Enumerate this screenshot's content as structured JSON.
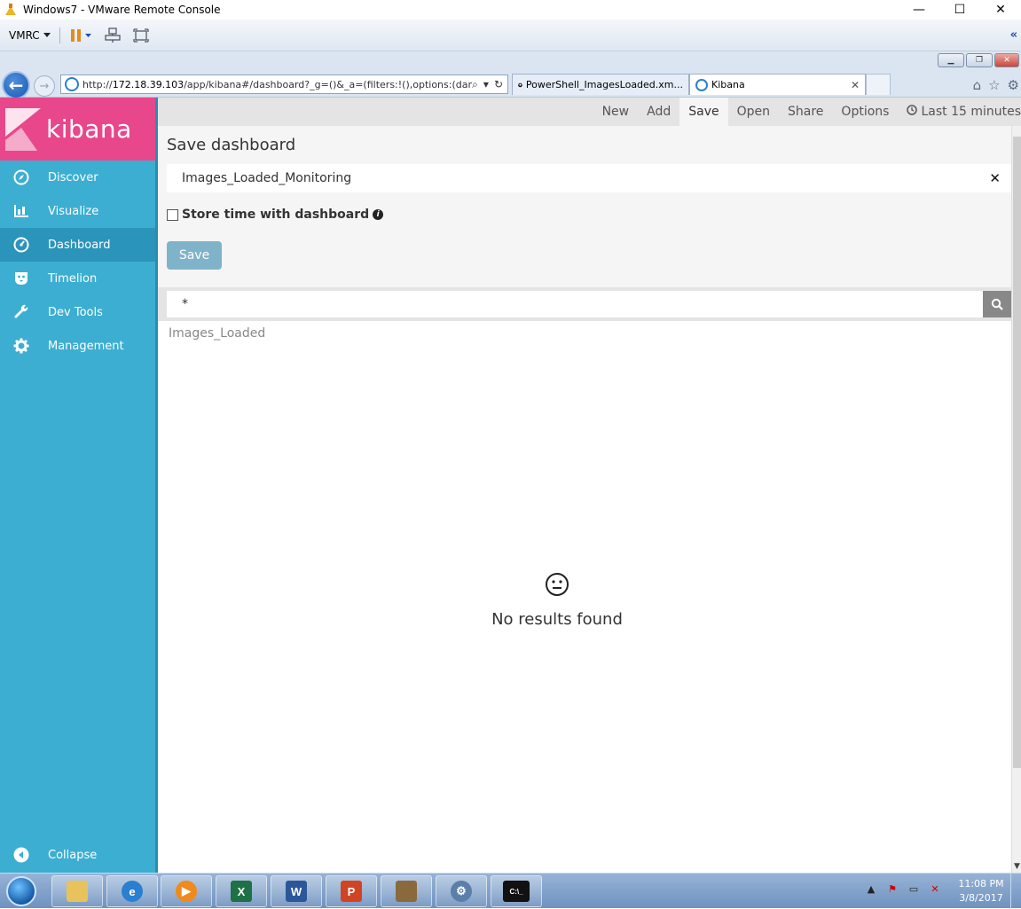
{
  "vm_window": {
    "title": "Windows7 - VMware Remote Console",
    "minimize": "—",
    "maximize": "☐",
    "close": "✕"
  },
  "vmrc_toolbar": {
    "menu_label": "VMRC",
    "collapse": "«"
  },
  "browser": {
    "address": {
      "url_prefix": "http://",
      "url_host": "172.18.39.103",
      "url_rest": "/app/kibana#/dashboard?_g=()&_a=(filters:!(),options:(darkT"
    },
    "tabs": [
      {
        "label": "PowerShell_ImagesLoaded.xm..."
      },
      {
        "label": "Kibana",
        "close": "✕"
      }
    ]
  },
  "kibana": {
    "logo_text": "kibana",
    "nav": [
      {
        "label": "Discover",
        "icon": "compass-icon"
      },
      {
        "label": "Visualize",
        "icon": "bar-chart-icon"
      },
      {
        "label": "Dashboard",
        "icon": "dashboard-gauge-icon",
        "active": true
      },
      {
        "label": "Timelion",
        "icon": "timelion-icon"
      },
      {
        "label": "Dev Tools",
        "icon": "wrench-icon"
      },
      {
        "label": "Management",
        "icon": "gear-icon"
      }
    ],
    "collapse_label": "Collapse",
    "topnav": {
      "new": "New",
      "add": "Add",
      "save": "Save",
      "open": "Open",
      "share": "Share",
      "options": "Options",
      "time": "Last 15 minutes"
    },
    "save_panel": {
      "heading": "Save dashboard",
      "name_value": "Images_Loaded_Monitoring",
      "store_time_label": "Store time with dashboard",
      "store_time_checked": false,
      "save_button": "Save"
    },
    "query": {
      "value": "*"
    },
    "panel_title": "Images_Loaded",
    "no_results": "No results found"
  },
  "taskbar": {
    "apps": [
      "explorer-icon",
      "internet-explorer-icon",
      "media-player-icon",
      "excel-icon",
      "word-icon",
      "powerpoint-icon",
      "archive-icon",
      "settings-gears-icon",
      "cmd-icon"
    ],
    "clock_time": "11:08 PM",
    "clock_date": "3/8/2017"
  },
  "colors": {
    "kibana_pink": "#e8478b",
    "sidebar_blue": "#3caed2",
    "sidebar_active": "#2b94ba",
    "save_button": "#7fb3c9"
  }
}
